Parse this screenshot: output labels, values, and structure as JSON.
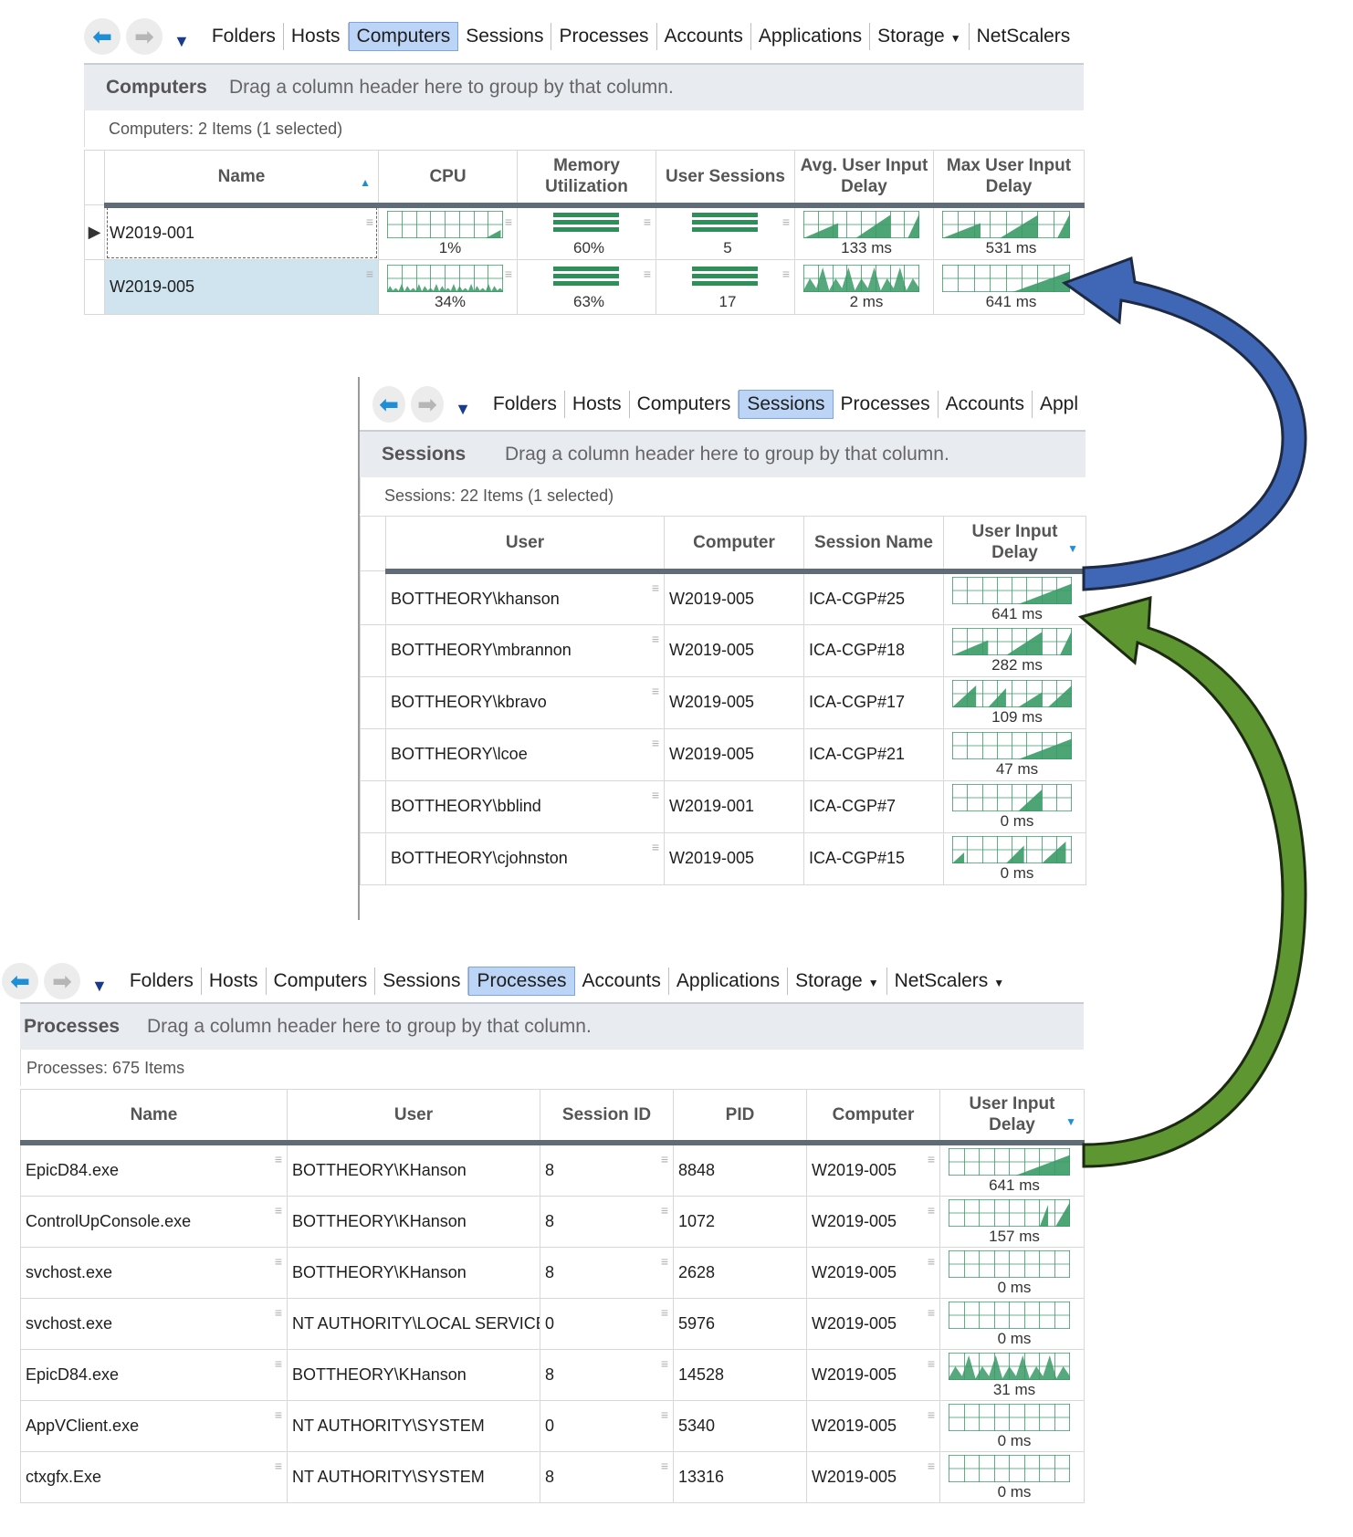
{
  "nav": {
    "computers_view": [
      "Folders",
      "Hosts",
      "Computers",
      "Sessions",
      "Processes",
      "Accounts",
      "Applications",
      "Storage",
      "NetScalers"
    ],
    "sessions_view": [
      "Folders",
      "Hosts",
      "Computers",
      "Sessions",
      "Processes",
      "Accounts",
      "Appl"
    ],
    "processes_view": [
      "Folders",
      "Hosts",
      "Computers",
      "Sessions",
      "Processes",
      "Accounts",
      "Applications",
      "Storage",
      "NetScalers"
    ]
  },
  "computers": {
    "title": "Computers",
    "hint": "Drag a column header here to group by that column.",
    "count": "Computers: 2 Items (1 selected)",
    "headers": [
      "Name",
      "CPU",
      "Memory Utilization",
      "User Sessions",
      "Avg. User Input Delay",
      "Max User Input Delay"
    ],
    "rows": [
      {
        "name": "W2019-001",
        "cpu": "1%",
        "cpu_level": 0.05,
        "memory": "60%",
        "sessions": "5",
        "avg_delay": "133 ms",
        "max_delay": "531 ms"
      },
      {
        "name": "W2019-005",
        "cpu": "34%",
        "cpu_level": 0.34,
        "memory": "63%",
        "sessions": "17",
        "avg_delay": "2 ms",
        "max_delay": "641 ms"
      }
    ]
  },
  "sessions": {
    "title": "Sessions",
    "hint": "Drag a column header here to group by that column.",
    "count": "Sessions: 22 Items (1 selected)",
    "headers": [
      "User",
      "Computer",
      "Session Name",
      "User Input Delay"
    ],
    "rows": [
      {
        "user": "BOTTHEORY\\khanson",
        "computer": "W2019-005",
        "session": "ICA-CGP#25",
        "delay": "641 ms"
      },
      {
        "user": "BOTTHEORY\\mbrannon",
        "computer": "W2019-005",
        "session": "ICA-CGP#18",
        "delay": "282 ms"
      },
      {
        "user": "BOTTHEORY\\kbravo",
        "computer": "W2019-005",
        "session": "ICA-CGP#17",
        "delay": "109 ms"
      },
      {
        "user": "BOTTHEORY\\lcoe",
        "computer": "W2019-005",
        "session": "ICA-CGP#21",
        "delay": "47 ms"
      },
      {
        "user": "BOTTHEORY\\bblind",
        "computer": "W2019-001",
        "session": "ICA-CGP#7",
        "delay": "0 ms"
      },
      {
        "user": "BOTTHEORY\\cjohnston",
        "computer": "W2019-005",
        "session": "ICA-CGP#15",
        "delay": "0 ms"
      }
    ]
  },
  "processes": {
    "title": "Processes",
    "hint": "Drag a column header here to group by that column.",
    "count": "Processes: 675 Items",
    "headers": [
      "Name",
      "User",
      "Session ID",
      "PID",
      "Computer",
      "User Input Delay"
    ],
    "rows": [
      {
        "name": "EpicD84.exe",
        "user": "BOTTHEORY\\KHanson",
        "session_id": "8",
        "pid": "8848",
        "computer": "W2019-005",
        "delay": "641 ms"
      },
      {
        "name": "ControlUpConsole.exe",
        "user": "BOTTHEORY\\KHanson",
        "session_id": "8",
        "pid": "1072",
        "computer": "W2019-005",
        "delay": "157 ms"
      },
      {
        "name": "svchost.exe",
        "user": "BOTTHEORY\\KHanson",
        "session_id": "8",
        "pid": "2628",
        "computer": "W2019-005",
        "delay": "0 ms"
      },
      {
        "name": "svchost.exe",
        "user": "NT AUTHORITY\\LOCAL SERVICE",
        "session_id": "0",
        "pid": "5976",
        "computer": "W2019-005",
        "delay": "0 ms"
      },
      {
        "name": "EpicD84.exe",
        "user": "BOTTHEORY\\KHanson",
        "session_id": "8",
        "pid": "14528",
        "computer": "W2019-005",
        "delay": "31 ms"
      },
      {
        "name": "AppVClient.exe",
        "user": "NT AUTHORITY\\SYSTEM",
        "session_id": "0",
        "pid": "5340",
        "computer": "W2019-005",
        "delay": "0 ms"
      },
      {
        "name": "ctxgfx.Exe",
        "user": "NT AUTHORITY\\SYSTEM",
        "session_id": "8",
        "pid": "13316",
        "computer": "W2019-005",
        "delay": "0 ms"
      }
    ]
  },
  "colors": {
    "spark_fill": "#3a9a66",
    "spark_grid": "#3a9a66",
    "blue_arrow": "#3f67b5",
    "green_arrow": "#5e9632",
    "active_tab": "#bcd4f5"
  }
}
